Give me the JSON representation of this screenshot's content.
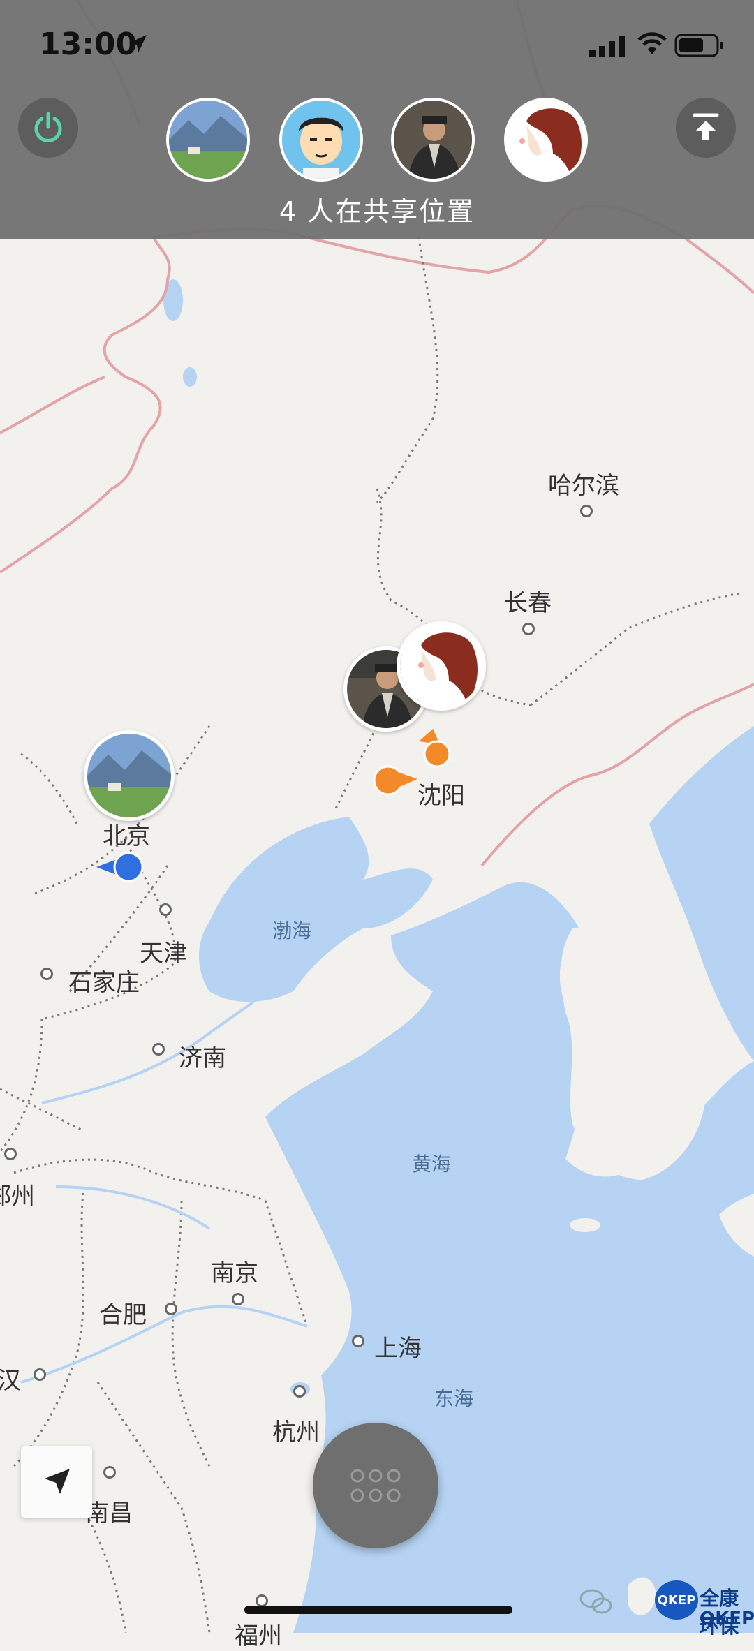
{
  "status_bar": {
    "time": "13:00"
  },
  "header": {
    "sharing_text": "4 人在共享位置"
  },
  "map": {
    "cities": [
      {
        "name": "哈尔滨"
      },
      {
        "name": "长春"
      },
      {
        "name": "沈阳"
      },
      {
        "name": "北京"
      },
      {
        "name": "天津"
      },
      {
        "name": "石家庄"
      },
      {
        "name": "济南"
      },
      {
        "name": "郑州"
      },
      {
        "name": "南京"
      },
      {
        "name": "合肥"
      },
      {
        "name": "上海"
      },
      {
        "name": "杭州"
      },
      {
        "name": "南昌"
      },
      {
        "name": "福州"
      },
      {
        "name": "汉"
      }
    ],
    "seas": [
      {
        "name": "渤海"
      },
      {
        "name": "黄海"
      },
      {
        "name": "东海"
      }
    ]
  },
  "colors": {
    "water": "#b6d3f3",
    "land": "#f2f1ee",
    "border_pink": "#e3a4a8",
    "me_blue": "#2f6fe0",
    "friend_orange": "#f38a2a",
    "overlay": "#6e6e6e",
    "power_green": "#59d4ad"
  },
  "icons": {
    "power": "power-icon",
    "top": "arrow-to-top-icon",
    "locate": "location-arrow-icon",
    "menu": "dots-grid-icon"
  },
  "watermark": {
    "brand": "QKEP",
    "line1": "全康环保",
    "line2": "QKEP"
  }
}
